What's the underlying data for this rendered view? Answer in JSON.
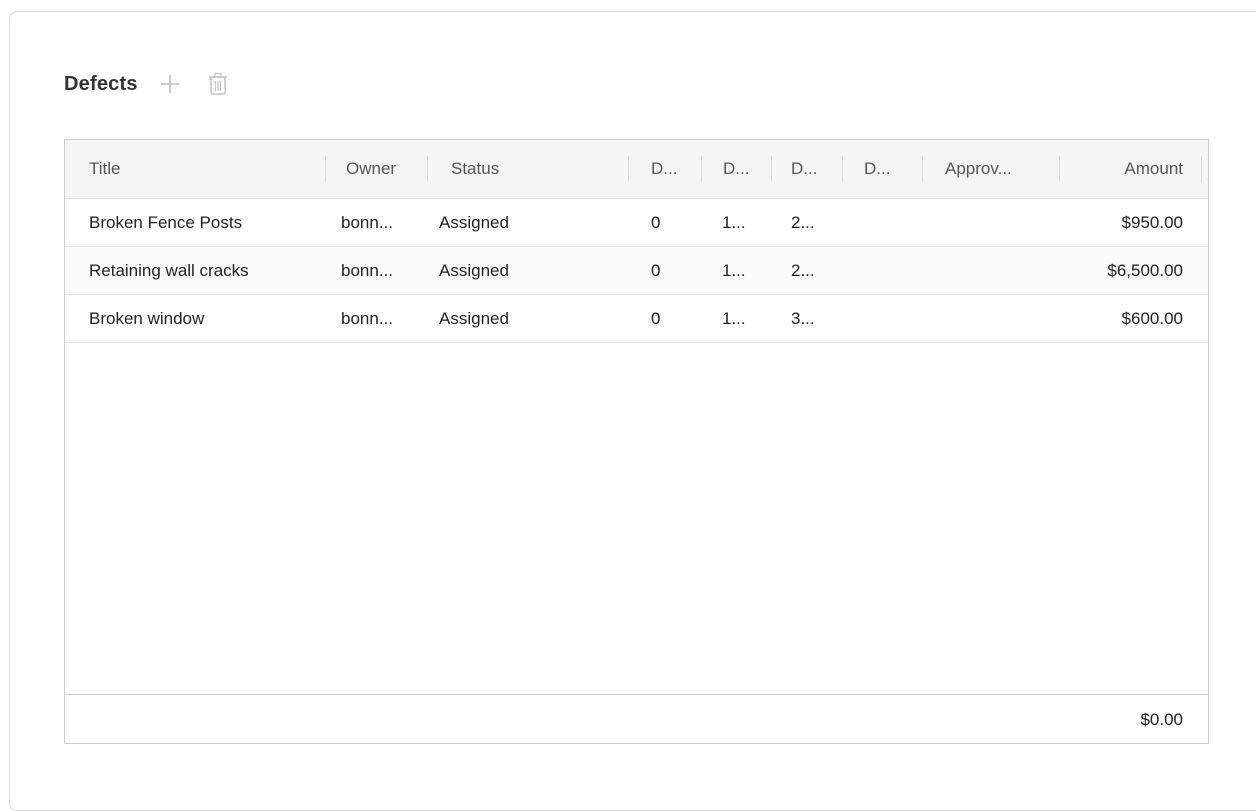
{
  "section": {
    "title": "Defects",
    "add_icon": "plus-icon",
    "delete_icon": "trash-icon"
  },
  "table": {
    "columns": [
      "Title",
      "Owner",
      "Status",
      "D...",
      "D...",
      "D...",
      "D...",
      "Approv...",
      "Amount"
    ],
    "rows": [
      [
        "Broken Fence Posts",
        "bonn...",
        "Assigned",
        "0",
        "1...",
        "2...",
        "",
        "",
        "$950.00"
      ],
      [
        "Retaining wall cracks",
        "bonn...",
        "Assigned",
        "0",
        "1...",
        "2...",
        "",
        "",
        "$6,500.00"
      ],
      [
        "Broken window",
        "bonn...",
        "Assigned",
        "0",
        "1...",
        "3...",
        "",
        "",
        "$600.00"
      ]
    ],
    "footer_total": "$0.00"
  },
  "colors": {
    "icon_muted": "#bdbdbd",
    "header_bg": "#f4f6f5",
    "border": "#c9cdcd"
  }
}
